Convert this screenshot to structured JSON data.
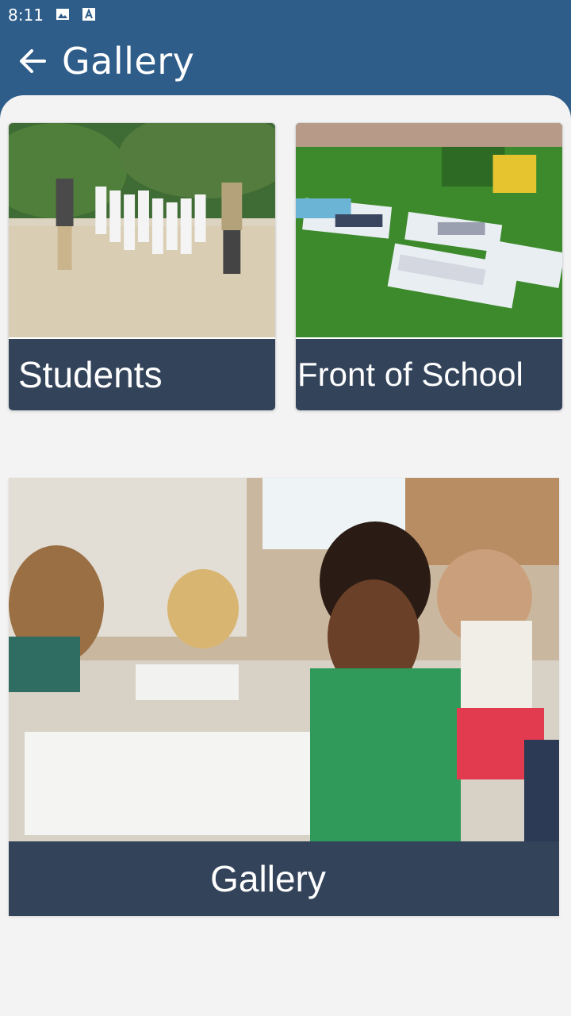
{
  "status_bar": {
    "time": "8:11"
  },
  "app_bar": {
    "title": "Gallery"
  },
  "cards": [
    {
      "caption": "Students"
    },
    {
      "caption": "Front of School"
    }
  ],
  "feature": {
    "caption": "Gallery"
  },
  "colors": {
    "primary": "#2f5d8a",
    "caption_bg": "#33435a",
    "background": "#f3f3f3"
  }
}
